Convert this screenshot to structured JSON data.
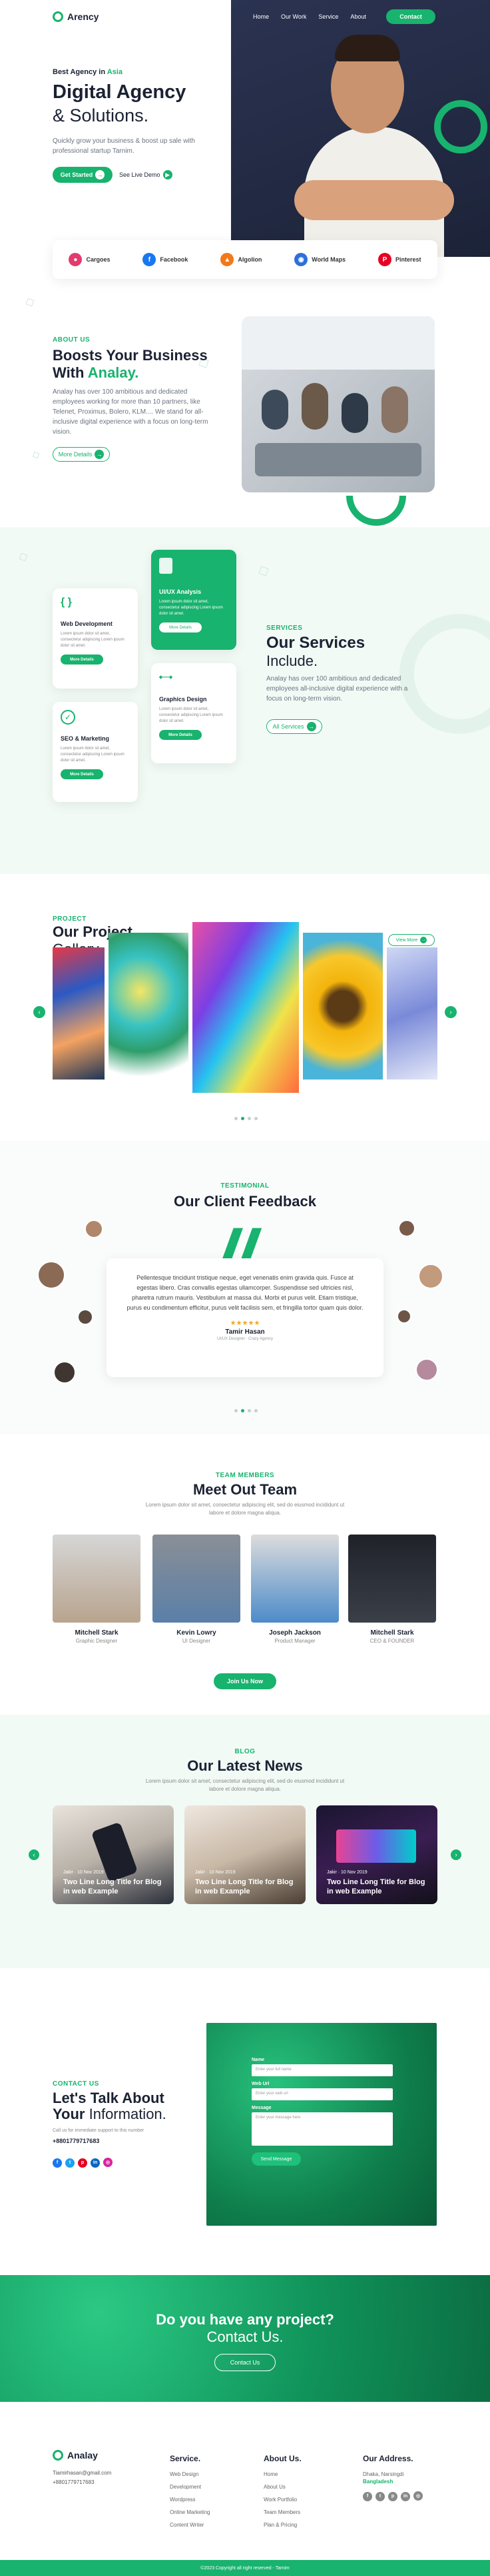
{
  "nav": {
    "logo": "Arency",
    "items": [
      "Home",
      "Our Work",
      "Service",
      "About"
    ],
    "contact": "Contact"
  },
  "hero": {
    "tag_prefix": "Best Agency in",
    "tag_accent": "Asia",
    "title1": "Digital Agency",
    "title2": "& Solutions.",
    "desc": "Quickly grow your business & boost up sale with professional startup Tarnim.",
    "cta": "Get Started",
    "demo": "See Live Demo"
  },
  "brands": [
    "Cargoes",
    "Facebook",
    "Algolion",
    "World Maps",
    "Pinterest"
  ],
  "about": {
    "tag": "ABOUT US",
    "title1": "Boosts Your Business",
    "title2": "With",
    "title_accent": "Analay.",
    "desc": "Analay has over 100 ambitious and dedicated employees working for more than 10 partners, like Telenet, Proximus, Bolero, KLM.... We stand for all-inclusive digital experience with a focus on long-term vision.",
    "more": "More Details"
  },
  "services": {
    "tag": "SERVICES",
    "title": "Our Services",
    "title2": "Include.",
    "desc": "Analay has over 100 ambitious and dedicated employees all-inclusive digital experience with a focus on long-term vision.",
    "all": "All Services",
    "cards": [
      {
        "title": "Web Development",
        "text": "Lorem ipsum dolor sit amet, consectetur adipiscing Lorem ipsum dolor sit amet.",
        "btn": "More Details"
      },
      {
        "title": "UI/UX Analysis",
        "text": "Lorem ipsum dolor sit amet, consectetur adipiscing Lorem ipsum dolor sit amet.",
        "btn": "More Details"
      },
      {
        "title": "SEO & Marketing",
        "text": "Lorem ipsum dolor sit amet, consectetur adipiscing Lorem ipsum dolor sit amet.",
        "btn": "More Details"
      },
      {
        "title": "Graphics Design",
        "text": "Lorem ipsum dolor sit amet, consectetur adipiscing Lorem ipsum dolor sit amet.",
        "btn": "More Details"
      }
    ]
  },
  "project": {
    "tag": "PROJECT",
    "title": "Our Project",
    "title2": "Gallery.",
    "view": "View More"
  },
  "testimonial": {
    "tag": "TESTIMONIAL",
    "title": "Our Client Feedback",
    "quote": "Pellentesque tincidunt tristique neque, eget venenatis enim gravida quis. Fusce at egestas libero. Cras convallis egestas ullamcorper. Suspendisse sed ultricies nisl, pharetra rutrum mauris. Vestibulum at massa dui. Morbi et purus velit. Etiam tristique, purus eu condimentum efficitur, purus velit facilisis sem, et fringilla tortor quam quis dolor.",
    "stars": "★★★★★",
    "name": "Tamir Hasan",
    "role": "UI/UX Designer - Crazy Agency"
  },
  "team": {
    "tag": "TEAM MEMBERS",
    "title": "Meet Out Team",
    "desc": "Lorem ipsum dolor sit amet, consectetur adipiscing elit, sed do eiusmod incididunt ut labore et dolore magna aliqua.",
    "members": [
      {
        "name": "Mitchell Stark",
        "role": "Graphic Designer"
      },
      {
        "name": "Kevin Lowry",
        "role": "UI Designer"
      },
      {
        "name": "Joseph Jackson",
        "role": "Product Manager"
      },
      {
        "name": "Mitchell Stark",
        "role": "CEO & FOUNDER"
      }
    ],
    "join": "Join Us Now"
  },
  "blog": {
    "tag": "BLOG",
    "title": "Our Latest News",
    "desc": "Lorem ipsum dolor sit amet, consectetur adipiscing elit, sed do eiusmod incididunt ut labore et dolore magna aliqua.",
    "posts": [
      {
        "meta": "Jakir · 10 Nov 2019",
        "title": "Two Line Long Title for Blog in web Example"
      },
      {
        "meta": "Jakir · 10 Nov 2019",
        "title": "Two Line Long Title for Blog in web Example"
      },
      {
        "meta": "Jakir · 10 Nov 2019",
        "title": "Two Line Long Title for Blog in web Example"
      }
    ]
  },
  "contact": {
    "tag": "CONTACT US",
    "title1": "Let's Talk About",
    "title2a": "Your",
    "title2b": "Information.",
    "note": "Call us for immediate support to this number",
    "phone": "+8801779717683",
    "form": {
      "name": "Name",
      "name_ph": "Enter your full name",
      "email": "Web Url",
      "email_ph": "Enter your web url",
      "message": "Message",
      "message_ph": "Enter your message here",
      "send": "Send Message"
    }
  },
  "cta": {
    "line1": "Do you have any project?",
    "line2": "Contact Us.",
    "btn": "Contact Us"
  },
  "footer": {
    "logo": "Analay",
    "email": "Tiamirhasan@gmail.com",
    "phone": "+8801779717683",
    "service_h": "Service.",
    "services": [
      "Web Design",
      "Development",
      "Wordpress",
      "Online Marketing",
      "Content Writer"
    ],
    "about_h": "About Us.",
    "about": [
      "Home",
      "About Us",
      "Work Portfolio",
      "Team Members",
      "Plan & Pricing"
    ],
    "address_h": "Our Address.",
    "address1": "Dhaka, Narsingdi",
    "address2": "Bangladesh",
    "copyright": "©2023 Copyright all right reserved - Tarnim"
  }
}
